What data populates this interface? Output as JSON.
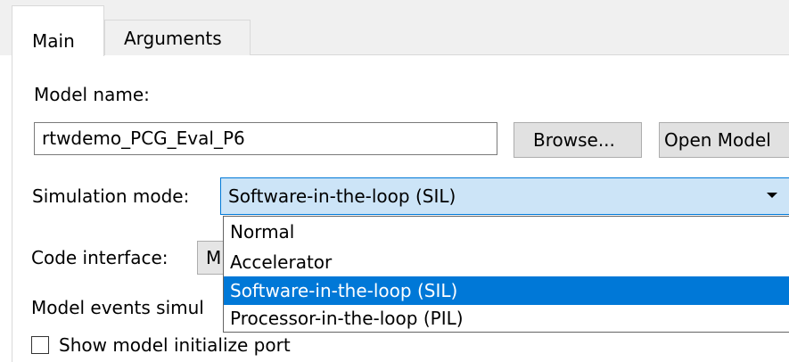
{
  "tabs": {
    "main": "Main",
    "arguments": "Arguments"
  },
  "model_name": {
    "label": "Model name:",
    "value": "rtwdemo_PCG_Eval_P6",
    "browse_button": "Browse...",
    "open_button": "Open Model"
  },
  "simulation_mode": {
    "label": "Simulation mode:",
    "selected": "Software-in-the-loop (SIL)",
    "options": [
      "Normal",
      "Accelerator",
      "Software-in-the-loop (SIL)",
      "Processor-in-the-loop (PIL)"
    ],
    "highlighted_index": 2
  },
  "code_interface": {
    "label": "Code interface:",
    "value_visible": "M"
  },
  "model_events": {
    "label_visible": "Model events simul"
  },
  "initialize_port": {
    "label": "Show model initialize port",
    "checked": false
  },
  "colors": {
    "selection_blue": "#0078d7",
    "combo_focus_fill": "#cce4f7",
    "tab_strip_bg": "#f0f0f0",
    "button_bg": "#e1e1e1"
  },
  "icons": {
    "dropdown_arrow": "chevron-down-icon",
    "checkbox": "checkbox-unchecked-icon"
  }
}
